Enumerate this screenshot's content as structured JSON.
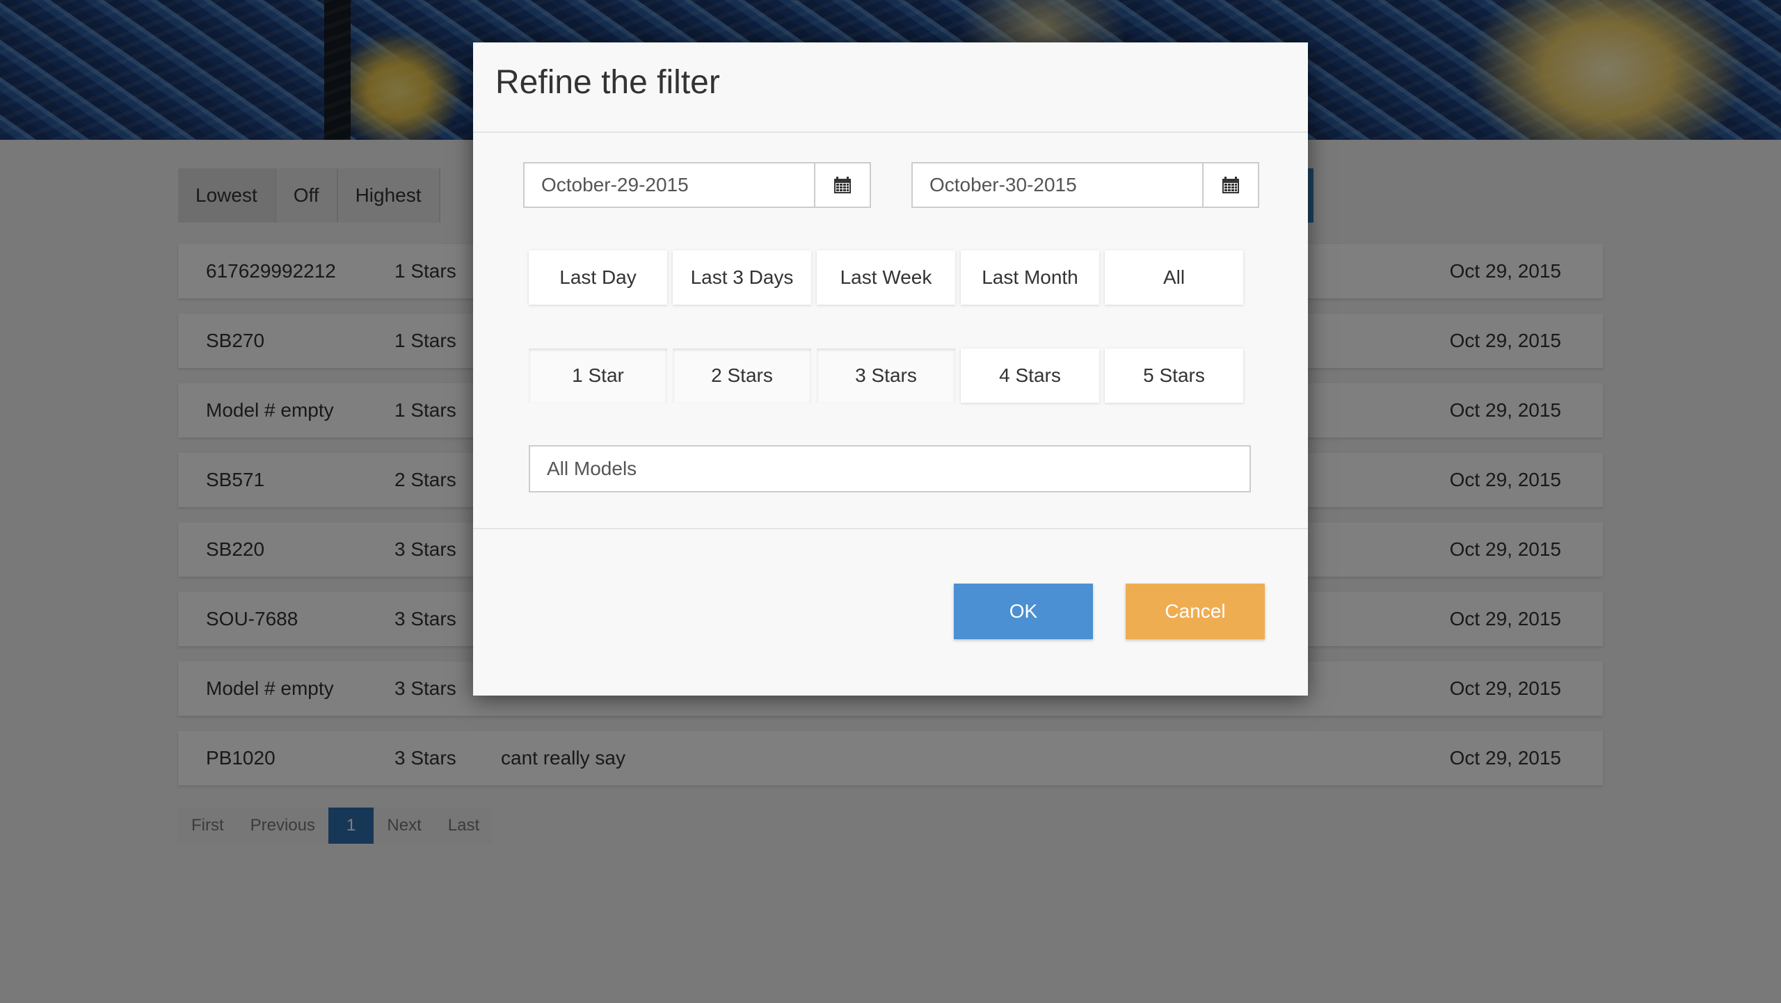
{
  "sort_buttons": [
    "Lowest",
    "Off",
    "Highest"
  ],
  "reviews": [
    {
      "model": "617629992212",
      "stars": "1 Stars",
      "text": "",
      "date": "Oct 29, 2015"
    },
    {
      "model": "SB270",
      "stars": "1 Stars",
      "text": "",
      "date": "Oct 29, 2015"
    },
    {
      "model": "Model # empty",
      "stars": "1 Stars",
      "text": "",
      "date": "Oct 29, 2015"
    },
    {
      "model": "SB571",
      "stars": "2 Stars",
      "text": "",
      "date": "Oct 29, 2015"
    },
    {
      "model": "SB220",
      "stars": "3 Stars",
      "text": "",
      "date": "Oct 29, 2015"
    },
    {
      "model": "SOU-7688",
      "stars": "3 Stars",
      "text": "",
      "date": "Oct 29, 2015"
    },
    {
      "model": "Model # empty",
      "stars": "3 Stars",
      "text": "",
      "date": "Oct 29, 2015"
    },
    {
      "model": "PB1020",
      "stars": "3 Stars",
      "text": "cant really say",
      "date": "Oct 29, 2015"
    }
  ],
  "pagination": {
    "first": "First",
    "previous": "Previous",
    "current": "1",
    "next": "Next",
    "last": "Last"
  },
  "modal": {
    "title": "Refine the filter",
    "start_date": "October-29-2015",
    "end_date": "October-30-2015",
    "range_buttons": [
      "Last Day",
      "Last 3 Days",
      "Last Week",
      "Last Month",
      "All"
    ],
    "star_buttons": [
      "1 Star",
      "2 Stars",
      "3 Stars",
      "4 Stars",
      "5 Stars"
    ],
    "models_value": "All Models",
    "ok_label": "OK",
    "cancel_label": "Cancel"
  },
  "colors": {
    "ok": "#4a90d2",
    "cancel": "#efad52",
    "pager_current": "#2f6fae"
  },
  "icons": {
    "date_picker": "calendar-icon"
  }
}
